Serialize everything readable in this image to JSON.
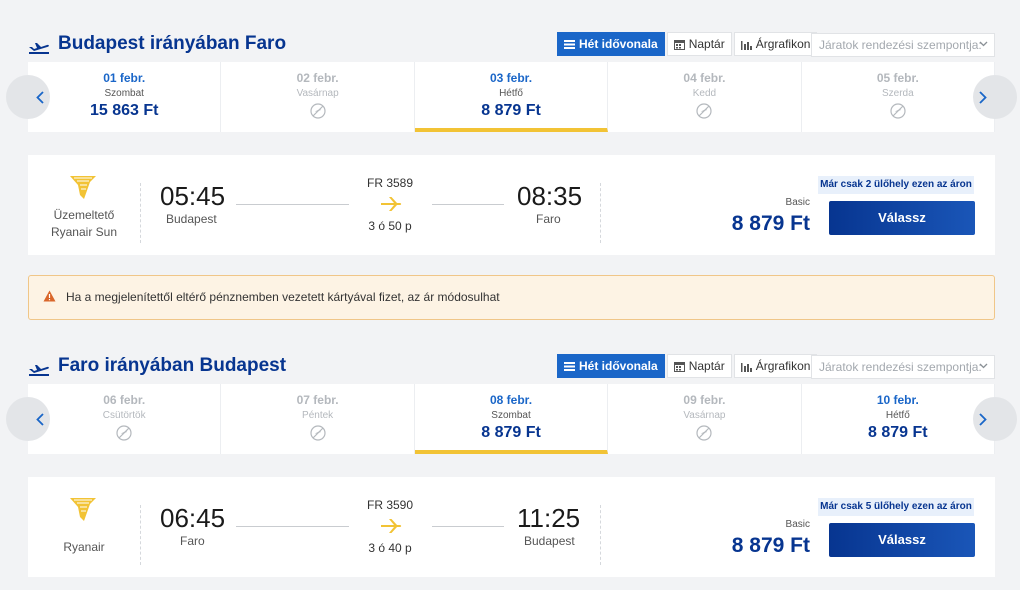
{
  "common": {
    "views": [
      {
        "label": "Hét idővonala",
        "icon": "list-icon"
      },
      {
        "label": "Naptár",
        "icon": "calendar-icon"
      },
      {
        "label": "Árgrafikon",
        "icon": "bar-chart-icon"
      }
    ],
    "sort_placeholder": "Járatok rendezési szempontja:",
    "operator_label": "Üzemeltető",
    "fare_label": "Basic",
    "choose_label": "Válassz"
  },
  "outbound": {
    "title": "Budapest irányában Faro",
    "dates": [
      {
        "date": "01 febr.",
        "weekday": "Szombat",
        "price": "15 863 Ft",
        "available": true
      },
      {
        "date": "02 febr.",
        "weekday": "Vasárnap",
        "price": "",
        "available": false
      },
      {
        "date": "03 febr.",
        "weekday": "Hétfő",
        "price": "8 879 Ft",
        "available": true,
        "selected": true
      },
      {
        "date": "04 febr.",
        "weekday": "Kedd",
        "price": "",
        "available": false
      },
      {
        "date": "05 febr.",
        "weekday": "Szerda",
        "price": "",
        "available": false
      }
    ],
    "flight": {
      "operator": "Ryanair Sun",
      "dep_time": "05:45",
      "dep_city": "Budapest",
      "flight_no": "FR 3589",
      "duration": "3 ó 50 p",
      "arr_time": "08:35",
      "arr_city": "Faro",
      "seats_left": "Már csak 2 ülőhely ezen az áron",
      "price": "8 879 Ft"
    }
  },
  "warning": {
    "text": "Ha a megjelenítettől eltérő pénznemben vezetett kártyával fizet, az ár módosulhat"
  },
  "inbound": {
    "title": "Faro irányában Budapest",
    "dates": [
      {
        "date": "06 febr.",
        "weekday": "Csütörtök",
        "price": "",
        "available": false
      },
      {
        "date": "07 febr.",
        "weekday": "Péntek",
        "price": "",
        "available": false
      },
      {
        "date": "08 febr.",
        "weekday": "Szombat",
        "price": "8 879 Ft",
        "available": true,
        "selected": true
      },
      {
        "date": "09 febr.",
        "weekday": "Vasárnap",
        "price": "",
        "available": false
      },
      {
        "date": "10 febr.",
        "weekday": "Hétfő",
        "price": "8 879 Ft",
        "available": true
      }
    ],
    "flight": {
      "operator": "Ryanair",
      "dep_time": "06:45",
      "dep_city": "Faro",
      "flight_no": "FR 3590",
      "duration": "3 ó 40 p",
      "arr_time": "11:25",
      "arr_city": "Budapest",
      "seats_left": "Már csak 5 ülőhely ezen az áron",
      "price": "8 879 Ft"
    }
  },
  "colors": {
    "brand_blue": "#073590",
    "accent_blue": "#1a66c8",
    "yellow": "#f2c335",
    "warning_bg": "#fdf3e4"
  }
}
